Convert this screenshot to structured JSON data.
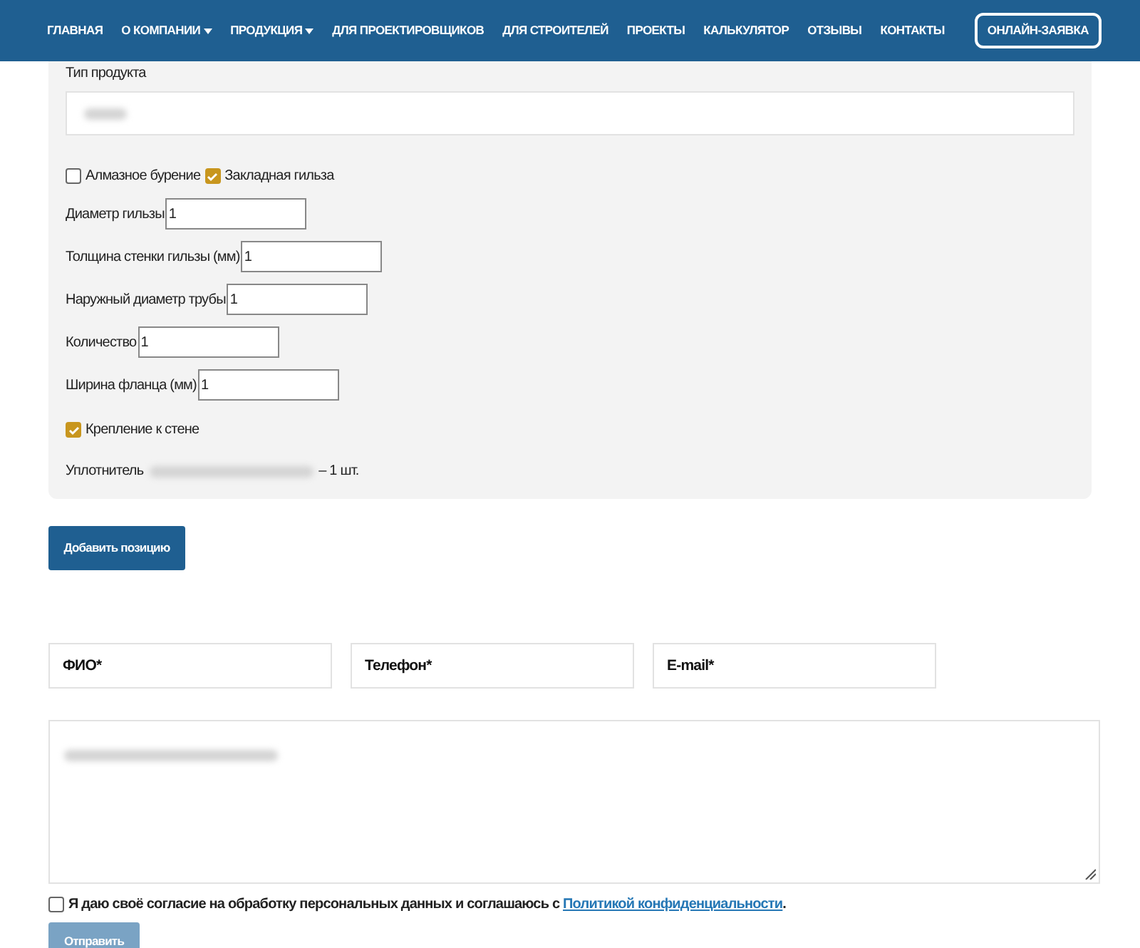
{
  "nav": {
    "items": [
      {
        "label": "ГЛАВНАЯ",
        "dropdown": false
      },
      {
        "label": "О КОМПАНИИ",
        "dropdown": true
      },
      {
        "label": "ПРОДУКЦИЯ",
        "dropdown": true
      },
      {
        "label": "ДЛЯ ПРОЕКТИРОВЩИКОВ",
        "dropdown": false
      },
      {
        "label": "ДЛЯ СТРОИТЕЛЕЙ",
        "dropdown": false
      },
      {
        "label": "ПРОЕКТЫ",
        "dropdown": false
      },
      {
        "label": "КАЛЬКУЛЯТОР",
        "dropdown": false
      },
      {
        "label": "ОТЗЫВЫ",
        "dropdown": false
      },
      {
        "label": "КОНТАКТЫ",
        "dropdown": false
      }
    ],
    "cta": "ОНЛАЙН-ЗАЯВКА"
  },
  "product": {
    "label": "Тип продукта",
    "options": [
      {
        "label": "Алмазное бурение",
        "checked": false
      },
      {
        "label": "Закладная гильза",
        "checked": true
      }
    ],
    "fields": [
      {
        "label": "Диаметр гильзы",
        "value": "1"
      },
      {
        "label": "Толщина стенки гильзы (мм)",
        "value": "1"
      },
      {
        "label": "Наружный диаметр трубы",
        "value": "1"
      },
      {
        "label": "Количество",
        "value": "1"
      },
      {
        "label": "Ширина фланца (мм)",
        "value": "1"
      }
    ],
    "mount": {
      "label": "Крепление к стене",
      "checked": true
    },
    "seal_label": "Уплотнитель",
    "seal_qty": "– 1 шт."
  },
  "add_button": "Добавить позицию",
  "contact": {
    "fields": [
      {
        "placeholder": "ФИО*"
      },
      {
        "placeholder": "Телефон*"
      },
      {
        "placeholder": "E-mail*"
      }
    ]
  },
  "consent": {
    "checked": false,
    "text": "Я даю своё согласие на обработку персональных данных и соглашаюсь с ",
    "link": "Политикой конфиденциальности",
    "end": "."
  },
  "submit": {
    "label": "Отправить",
    "disabled": true
  }
}
